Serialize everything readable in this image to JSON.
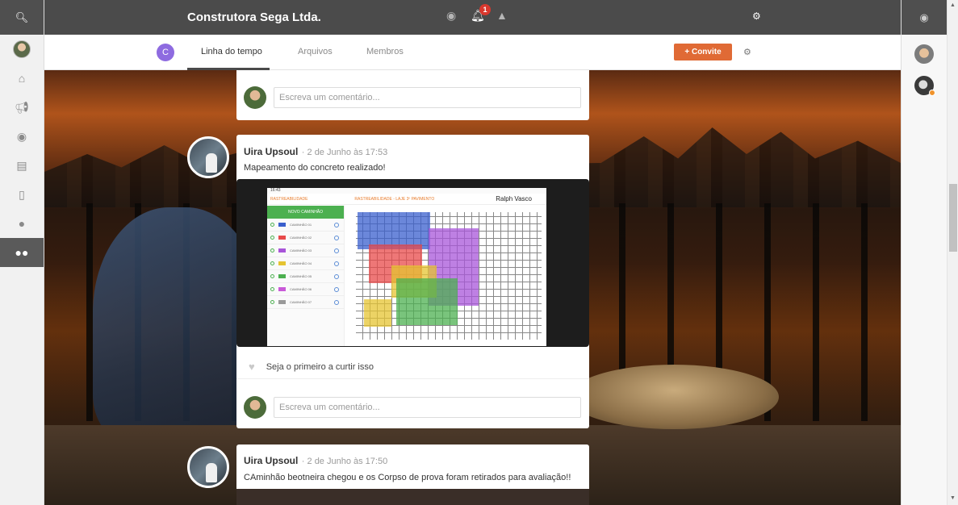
{
  "header": {
    "title": "Construtora Sega Ltda.",
    "notification_count": "1"
  },
  "subnav": {
    "group_initial": "C",
    "tabs": [
      {
        "label": "Linha do tempo"
      },
      {
        "label": "Arquivos"
      },
      {
        "label": "Membros"
      }
    ],
    "invite_label": "Convite"
  },
  "sidebar": {
    "icons": [
      "home-icon",
      "megaphone-icon",
      "chat-icon",
      "document-icon",
      "tablet-icon",
      "user-icon",
      "group-icon"
    ]
  },
  "comment_placeholder": "Escreva um comentário...",
  "posts": [
    {
      "author": "Uira Upsoul",
      "date": "· 2 de Junho às 17:53",
      "text": "Mapeamento do concreto realizado!",
      "like_text": "Seja o primeiro a curtir isso",
      "image": {
        "status_time": "16:43",
        "header_left": "RASTREABILIDADE",
        "header_center": "RASTREABILIDADE - LAJE 3º PAVIMENTO",
        "header_right": "Ralph Vasco",
        "new_path_label": "NOVO CAMINHÃO",
        "rows": [
          "CAMINHÃO 01",
          "CAMINHÃO 02",
          "CAMINHÃO 03",
          "CAMINHÃO 04",
          "CAMINHÃO 05",
          "CAMINHÃO 06",
          "CAMINHÃO 07"
        ],
        "row_colors": [
          "#3a5fcd",
          "#e84a4a",
          "#a855d9",
          "#e5c431",
          "#4cb050",
          "#c95ad8",
          "#9a9a9a"
        ]
      }
    },
    {
      "author": "Uira Upsoul",
      "date": "· 2 de Junho às 17:50",
      "text": "CAminhão beotneira chegou e os Corpso de prova foram retirados para avaliação!!"
    }
  ],
  "colors": {
    "accent": "#e06a35",
    "topbar": "#4b4b4b",
    "group_avatar": "#8e6be0"
  }
}
